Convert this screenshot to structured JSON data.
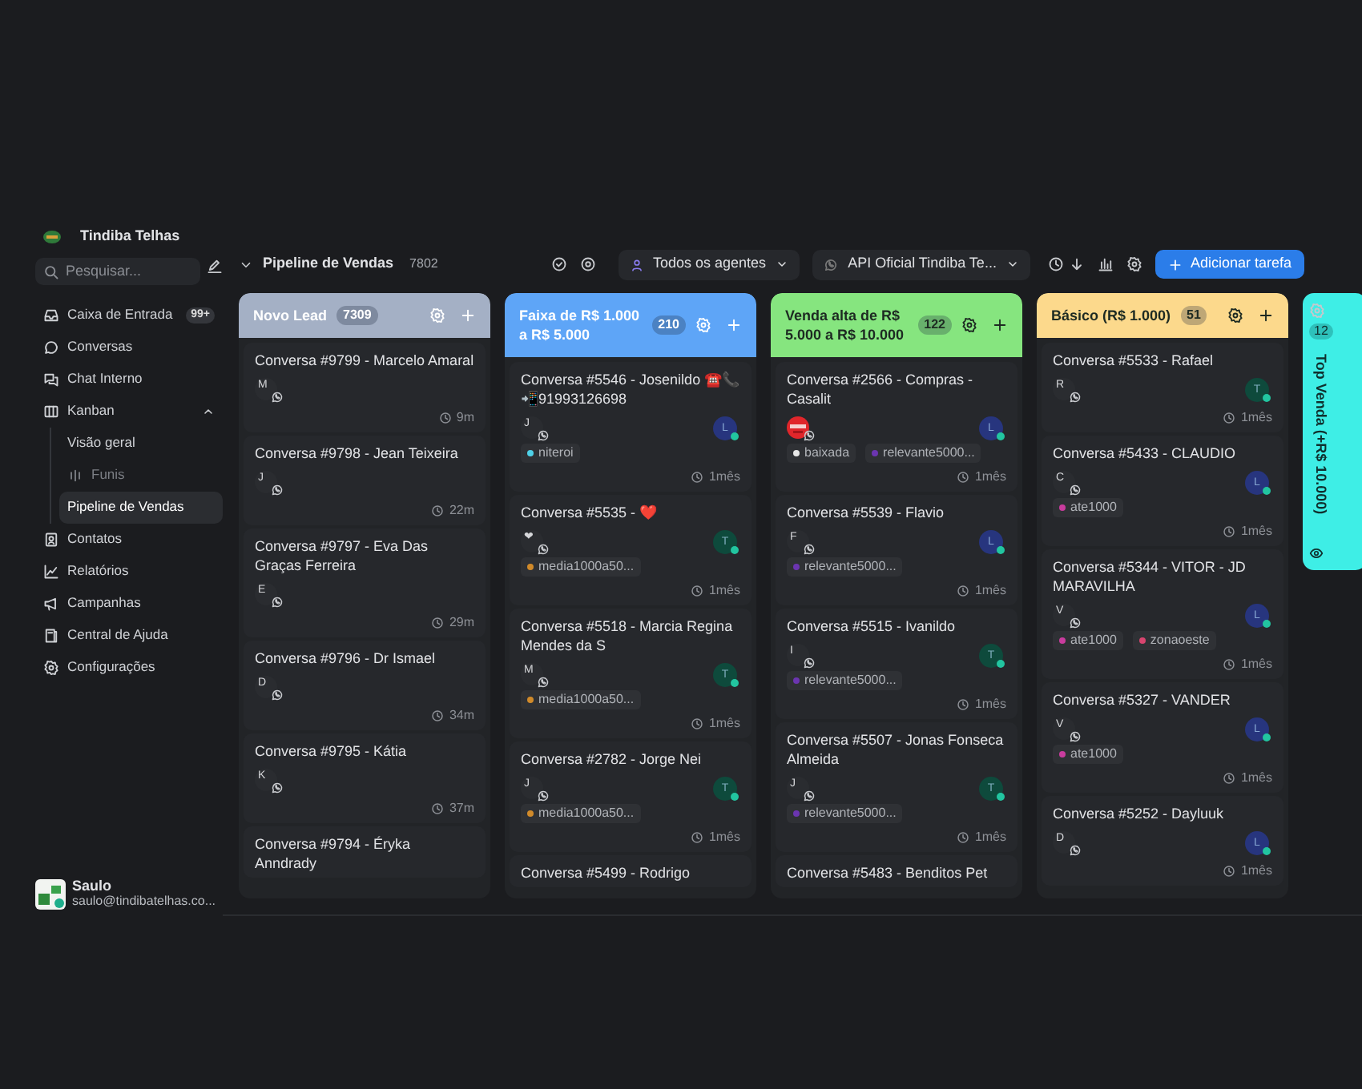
{
  "sidebar": {
    "brand": "Tindiba Telhas",
    "search": {
      "placeholder": "Pesquisar..."
    },
    "items": [
      {
        "label": "Caixa de Entrada",
        "badge": "99+",
        "selected": false
      },
      {
        "label": "Conversas",
        "selected": false
      },
      {
        "label": "Chat Interno",
        "selected": false
      },
      {
        "label": "Kanban",
        "selected": false,
        "expanded": true,
        "children": [
          {
            "label": "Visão geral",
            "kind": "link",
            "selected": false
          },
          {
            "label": "Funis",
            "kind": "group",
            "children": [
              {
                "label": "Pipeline de Vendas",
                "selected": true
              }
            ]
          }
        ]
      },
      {
        "label": "Contatos",
        "selected": false
      },
      {
        "label": "Relatórios",
        "selected": false
      },
      {
        "label": "Campanhas",
        "selected": false
      },
      {
        "label": "Central de Ajuda",
        "selected": false
      },
      {
        "label": "Configurações",
        "selected": false
      }
    ],
    "user": {
      "name": "Saulo",
      "email": "saulo@tindibatelhas.co..."
    }
  },
  "toolbar": {
    "title": "Pipeline de Vendas",
    "count": "7802",
    "agent_filter": "Todos os agentes",
    "inbox_filter": "API Oficial Tindiba Te...",
    "action": "Adicionar tarefa"
  },
  "columns": [
    {
      "title": "Novo Lead",
      "count": "7309",
      "color": "#a4b0c5",
      "collapsed": false,
      "cards": [
        {
          "title": "Conversa #9799 - Marcelo Amaral",
          "avatar": {
            "kind": "initial",
            "text": "M"
          },
          "time": "9m"
        },
        {
          "title": "Conversa #9798 - Jean Teixeira",
          "avatar": {
            "kind": "initial",
            "text": "J"
          },
          "time": "22m"
        },
        {
          "title": "Conversa #9797 - Eva Das Graças Ferreira",
          "avatar": {
            "kind": "initial",
            "text": "E"
          },
          "time": "29m"
        },
        {
          "title": "Conversa #9796 - Dr Ismael",
          "avatar": {
            "kind": "initial",
            "text": "D"
          },
          "time": "34m"
        },
        {
          "title": "Conversa #9795 - Kátia",
          "avatar": {
            "kind": "initial",
            "text": "K"
          },
          "time": "37m"
        },
        {
          "title": "Conversa #9794 - Éryka Anndrady"
        }
      ]
    },
    {
      "title": "Faixa de R$ 1.000 a R$ 5.000",
      "count": "210",
      "color": "#5ea5f7",
      "collapsed": false,
      "cards": [
        {
          "title": "Conversa #5546 - Josenildo ☎️📞📲91993126698",
          "avatar": {
            "kind": "initial",
            "text": "J"
          },
          "agent": {
            "text": "L",
            "color": "#27357e"
          },
          "tags": [
            {
              "label": "niteroi",
              "color": "#4fd1e8"
            }
          ],
          "time": "1mês"
        },
        {
          "title": "Conversa #5535 - ❤️",
          "avatar": {
            "kind": "initial",
            "text": "❤"
          },
          "agent": {
            "text": "T",
            "color": "#0e4a3c"
          },
          "tags": [
            {
              "label": "media1000a50...",
              "color": "#d08a2a"
            }
          ],
          "time": "1mês"
        },
        {
          "title": "Conversa #5518 - Marcia Regina Mendes da S",
          "avatar": {
            "kind": "initial",
            "text": "M"
          },
          "agent": {
            "text": "T",
            "color": "#0e4a3c"
          },
          "tags": [
            {
              "label": "media1000a50...",
              "color": "#d08a2a"
            }
          ],
          "time": "1mês"
        },
        {
          "title": "Conversa #2782 - Jorge Nei",
          "avatar": {
            "kind": "initial",
            "text": "J"
          },
          "agent": {
            "text": "T",
            "color": "#0e4a3c"
          },
          "tags": [
            {
              "label": "media1000a50...",
              "color": "#d08a2a"
            }
          ],
          "time": "1mês"
        },
        {
          "title": "Conversa #5499 - Rodrigo"
        }
      ]
    },
    {
      "title": "Venda alta de R$ 5.000 a R$ 10.000",
      "count": "122",
      "color": "#86e57f",
      "collapsed": false,
      "cards": [
        {
          "title": "Conversa #2566 - Compras - Casalit",
          "agent": {
            "text": "L",
            "color": "#27357e"
          },
          "tags": [
            {
              "label": "baixada",
              "color": "#e6e6e6"
            },
            {
              "label": "relevante5000...",
              "color": "#6b35b0"
            }
          ],
          "time": "1mês"
        },
        {
          "title": "Conversa #5539 - Flavio",
          "avatar": {
            "kind": "initial",
            "text": "F"
          },
          "agent": {
            "text": "L",
            "color": "#27357e"
          },
          "tags": [
            {
              "label": "relevante5000...",
              "color": "#6b35b0"
            }
          ],
          "time": "1mês"
        },
        {
          "title": "Conversa #5515 - Ivanildo",
          "avatar": {
            "kind": "initial",
            "text": "I"
          },
          "agent": {
            "text": "T",
            "color": "#0e4a3c"
          },
          "tags": [
            {
              "label": "relevante5000...",
              "color": "#6b35b0"
            }
          ],
          "time": "1mês"
        },
        {
          "title": "Conversa #5507 - Jonas Fonseca Almeida",
          "avatar": {
            "kind": "initial",
            "text": "J"
          },
          "agent": {
            "text": "T",
            "color": "#0e4a3c"
          },
          "tags": [
            {
              "label": "relevante5000...",
              "color": "#6b35b0"
            }
          ],
          "time": "1mês"
        },
        {
          "title": "Conversa #5483 - Benditos Pet"
        }
      ]
    },
    {
      "title": "Básico (R$ 1.000)",
      "count": "51",
      "color": "#fcd98c",
      "collapsed": false,
      "cards": [
        {
          "title": "Conversa #5533 - Rafael",
          "avatar": {
            "kind": "initial",
            "text": "R"
          },
          "agent": {
            "text": "T",
            "color": "#0e4a3c"
          },
          "time": "1mês"
        },
        {
          "title": "Conversa #5433 - CLAUDIO",
          "avatar": {
            "kind": "initial",
            "text": "C"
          },
          "agent": {
            "text": "L",
            "color": "#27357e"
          },
          "tags": [
            {
              "label": "ate1000",
              "color": "#c93c9e"
            }
          ],
          "time": "1mês"
        },
        {
          "title": "Conversa #5344 - VITOR - JD MARAVILHA",
          "avatar": {
            "kind": "initial",
            "text": "V"
          },
          "agent": {
            "text": "L",
            "color": "#27357e"
          },
          "tags": [
            {
              "label": "ate1000",
              "color": "#c93c9e"
            },
            {
              "label": "zonaoeste",
              "color": "#d8456f"
            }
          ],
          "time": "1mês"
        },
        {
          "title": "Conversa #5327 - VANDER",
          "avatar": {
            "kind": "initial",
            "text": "V"
          },
          "agent": {
            "text": "L",
            "color": "#27357e"
          },
          "tags": [
            {
              "label": "ate1000",
              "color": "#c93c9e"
            }
          ],
          "time": "1mês"
        },
        {
          "title": "Conversa #5252 - Dayluuk",
          "avatar": {
            "kind": "initial",
            "text": "D"
          },
          "agent": {
            "text": "L",
            "color": "#27357e"
          },
          "time": "1mês"
        }
      ]
    },
    {
      "title": "Top Venda (+R$ 10.000)",
      "count": "12",
      "color": "#3eeee6",
      "collapsed": true
    }
  ]
}
